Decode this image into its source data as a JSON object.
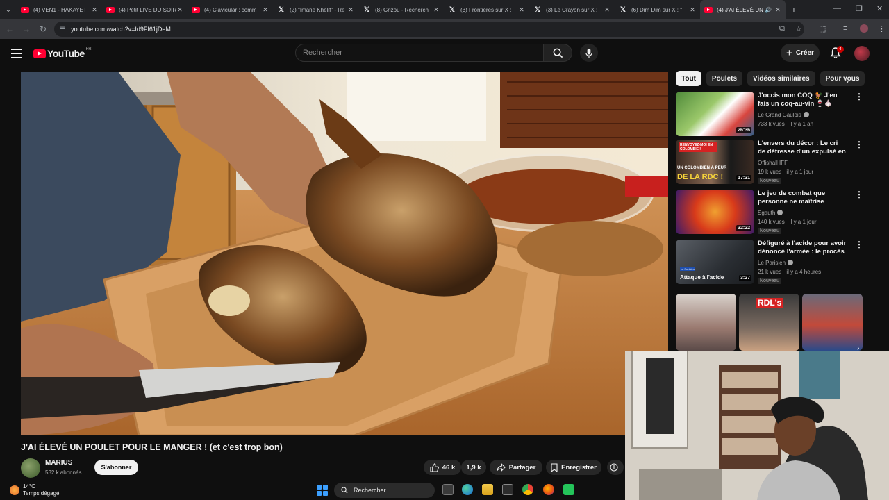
{
  "browser": {
    "tabs": [
      {
        "label": "(4) VEN1 - HAKAYET",
        "favicon": "youtube-icon"
      },
      {
        "label": "(4) Petit LIVE DU SOIR",
        "favicon": "youtube-icon"
      },
      {
        "label": "(4) Clavicular : comm",
        "favicon": "youtube-icon"
      },
      {
        "label": "(2) \"Imane Khelif\" - Re",
        "favicon": "x-icon"
      },
      {
        "label": "(8) Grizou - Recherch",
        "favicon": "x-icon"
      },
      {
        "label": "(3) Frontières sur X :",
        "favicon": "x-icon"
      },
      {
        "label": "(3) Le Crayon sur X :",
        "favicon": "x-icon"
      },
      {
        "label": "(6) Dim Dim sur X : \"",
        "favicon": "x-icon"
      },
      {
        "label": "(4) J'AI ÉLEVÉ UN",
        "favicon": "youtube-icon",
        "active": true
      }
    ],
    "url": "youtube.com/watch?v=Id9FI61jDeM"
  },
  "header": {
    "logo_text": "YouTube",
    "country_code": "FR",
    "search_placeholder": "Rechercher",
    "create_label": "Créer",
    "notifications_count": "4"
  },
  "chips": [
    "Tout",
    "Poulets",
    "Vidéos similaires",
    "Pour vous"
  ],
  "recommendations": [
    {
      "title": "J'occis mon COQ 🐓 J'en fais un coq-au-vin 🍷🧄",
      "channel": "Le Grand Gaulois",
      "verified": true,
      "meta": "733 k vues · il y a 1 an",
      "duration": "26:36",
      "badge": ""
    },
    {
      "title": "L'envers du décor : Le cri de détresse d'un expulsé en RDC",
      "channel": "Offishall IFF",
      "verified": false,
      "meta": "19 k vues · il y a 1 jour",
      "duration": "17:31",
      "badge": "Nouveau",
      "thumb_text_top": "RENVOYEZ-MOI EN COLOMBIE !",
      "thumb_text_mid": "UN COLOMBIEN À PEUR",
      "thumb_text_bot": "DE LA RDC !"
    },
    {
      "title": "Le jeu de combat que personne ne maîtrise",
      "channel": "Sgauth",
      "verified": true,
      "meta": "140 k vues · il y a 1 jour",
      "duration": "32:22",
      "badge": "Nouveau"
    },
    {
      "title": "Défiguré à l'acide pour avoir dénoncé l'armée : le procès qu...",
      "channel": "Le Parisien",
      "verified": true,
      "meta": "21 k vues · il y a 4 heures",
      "duration": "3:27",
      "badge": "Nouveau",
      "thumb_text": "Attaque à l'acide",
      "thumb_tag": "Le Parisien"
    }
  ],
  "shorts_label": "RDL's",
  "video": {
    "title": "J'AI ÉLEVÉ UN POULET POUR LE MANGER ! (et c'est trop bon)",
    "channel": "MARIUS",
    "subscribers": "532 k abonnés",
    "subscribe_label": "S'abonner",
    "likes": "46 k",
    "dislikes": "1,9 k",
    "share_label": "Partager",
    "save_label": "Enregistrer"
  },
  "taskbar": {
    "temperature": "14°C",
    "weather": "Temps dégagé",
    "search_label": "Rechercher"
  }
}
